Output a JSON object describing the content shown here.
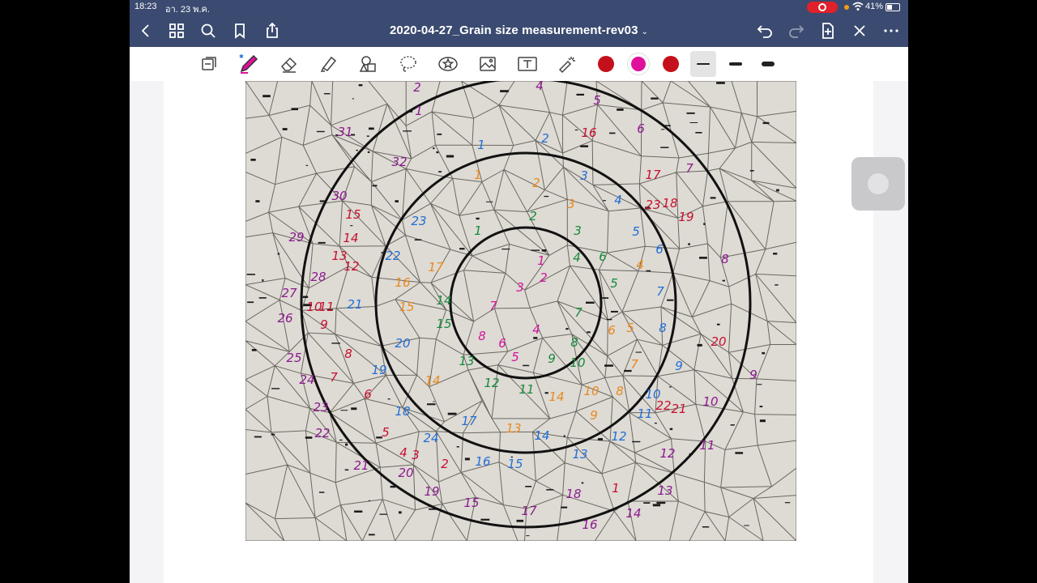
{
  "status": {
    "time": "18:23",
    "date": "อา. 23 พ.ค.",
    "battery": "41%"
  },
  "nav": {
    "title": "2020-04-27_Grain size measurement-rev03",
    "title_caret": "⌄"
  },
  "toolbar": {
    "tools": [
      "page-view-icon",
      "pen-icon",
      "eraser-icon",
      "highlighter-icon",
      "shapes-icon",
      "lasso-icon",
      "sticker-icon",
      "image-icon",
      "text-icon",
      "laser-pointer-icon"
    ],
    "colors": [
      "#c4101a",
      "#e0109a",
      "#c4101a"
    ],
    "active_color_index": 1,
    "active_stroke_index": 0
  },
  "colors": {
    "purple": "#8a1a8e",
    "red": "#c80f2e",
    "blue": "#1f6fd6",
    "orange": "#e8891c",
    "green": "#148a3c",
    "magenta": "#d4149a"
  },
  "labels": [
    {
      "t": "2",
      "c": "purple"
    },
    {
      "t": "4",
      "c": "purple"
    },
    {
      "t": "5",
      "c": "purple"
    },
    {
      "t": "1",
      "c": "purple"
    },
    {
      "t": "31",
      "c": "purple"
    },
    {
      "t": "1",
      "c": "blue"
    },
    {
      "t": "2",
      "c": "blue"
    },
    {
      "t": "16",
      "c": "red"
    },
    {
      "t": "6",
      "c": "purple"
    },
    {
      "t": "32",
      "c": "purple"
    },
    {
      "t": "1",
      "c": "orange"
    },
    {
      "t": "2",
      "c": "orange"
    },
    {
      "t": "3",
      "c": "blue"
    },
    {
      "t": "17",
      "c": "red"
    },
    {
      "t": "7",
      "c": "purple"
    },
    {
      "t": "30",
      "c": "purple"
    },
    {
      "t": "3",
      "c": "orange"
    },
    {
      "t": "4",
      "c": "blue"
    },
    {
      "t": "18",
      "c": "red"
    },
    {
      "t": "19",
      "c": "red"
    },
    {
      "t": "23",
      "c": "red"
    },
    {
      "t": "15",
      "c": "red"
    },
    {
      "t": "23",
      "c": "blue"
    },
    {
      "t": "2",
      "c": "green"
    },
    {
      "t": "29",
      "c": "purple"
    },
    {
      "t": "14",
      "c": "red"
    },
    {
      "t": "1",
      "c": "green"
    },
    {
      "t": "3",
      "c": "green"
    },
    {
      "t": "5",
      "c": "blue"
    },
    {
      "t": "22",
      "c": "blue"
    },
    {
      "t": "13",
      "c": "red"
    },
    {
      "t": "12",
      "c": "red"
    },
    {
      "t": "17",
      "c": "orange"
    },
    {
      "t": "1",
      "c": "magenta"
    },
    {
      "t": "4",
      "c": "green"
    },
    {
      "t": "6",
      "c": "green"
    },
    {
      "t": "6",
      "c": "blue"
    },
    {
      "t": "8",
      "c": "purple"
    },
    {
      "t": "4",
      "c": "orange"
    },
    {
      "t": "28",
      "c": "purple"
    },
    {
      "t": "16",
      "c": "orange"
    },
    {
      "t": "2",
      "c": "magenta"
    },
    {
      "t": "5",
      "c": "green"
    },
    {
      "t": "3",
      "c": "magenta"
    },
    {
      "t": "7",
      "c": "blue"
    },
    {
      "t": "27",
      "c": "purple"
    },
    {
      "t": "10",
      "c": "red"
    },
    {
      "t": "11",
      "c": "red"
    },
    {
      "t": "21",
      "c": "blue"
    },
    {
      "t": "14",
      "c": "green"
    },
    {
      "t": "15",
      "c": "orange"
    },
    {
      "t": "7",
      "c": "magenta"
    },
    {
      "t": "7",
      "c": "green"
    },
    {
      "t": "26",
      "c": "purple"
    },
    {
      "t": "9",
      "c": "red"
    },
    {
      "t": "15",
      "c": "green"
    },
    {
      "t": "4",
      "c": "magenta"
    },
    {
      "t": "6",
      "c": "orange"
    },
    {
      "t": "5",
      "c": "orange"
    },
    {
      "t": "8",
      "c": "blue"
    },
    {
      "t": "20",
      "c": "blue"
    },
    {
      "t": "8",
      "c": "magenta"
    },
    {
      "t": "6",
      "c": "magenta"
    },
    {
      "t": "8",
      "c": "green"
    },
    {
      "t": "20",
      "c": "red"
    },
    {
      "t": "8",
      "c": "red"
    },
    {
      "t": "5",
      "c": "magenta"
    },
    {
      "t": "9",
      "c": "green"
    },
    {
      "t": "10",
      "c": "green"
    },
    {
      "t": "25",
      "c": "purple"
    },
    {
      "t": "13",
      "c": "green"
    },
    {
      "t": "7",
      "c": "orange"
    },
    {
      "t": "9",
      "c": "blue"
    },
    {
      "t": "19",
      "c": "blue"
    },
    {
      "t": "24",
      "c": "purple"
    },
    {
      "t": "7",
      "c": "red"
    },
    {
      "t": "9",
      "c": "purple"
    },
    {
      "t": "12",
      "c": "green"
    },
    {
      "t": "14",
      "c": "orange"
    },
    {
      "t": "11",
      "c": "green"
    },
    {
      "t": "10",
      "c": "orange"
    },
    {
      "t": "8",
      "c": "orange"
    },
    {
      "t": "14",
      "c": "orange"
    },
    {
      "t": "6",
      "c": "red"
    },
    {
      "t": "10",
      "c": "blue"
    },
    {
      "t": "22",
      "c": "red"
    },
    {
      "t": "21",
      "c": "red"
    },
    {
      "t": "10",
      "c": "purple"
    },
    {
      "t": "23",
      "c": "purple"
    },
    {
      "t": "18",
      "c": "blue"
    },
    {
      "t": "9",
      "c": "orange"
    },
    {
      "t": "11",
      "c": "blue"
    },
    {
      "t": "17",
      "c": "blue"
    },
    {
      "t": "13",
      "c": "orange"
    },
    {
      "t": "22",
      "c": "purple"
    },
    {
      "t": "5",
      "c": "red"
    },
    {
      "t": "24",
      "c": "blue"
    },
    {
      "t": "14",
      "c": "blue"
    },
    {
      "t": "12",
      "c": "blue"
    },
    {
      "t": "11",
      "c": "purple"
    },
    {
      "t": "4",
      "c": "red"
    },
    {
      "t": "3",
      "c": "red"
    },
    {
      "t": "2",
      "c": "red"
    },
    {
      "t": "16",
      "c": "blue"
    },
    {
      "t": "15",
      "c": "blue"
    },
    {
      "t": "13",
      "c": "blue"
    },
    {
      "t": "12",
      "c": "purple"
    },
    {
      "t": "21",
      "c": "purple"
    },
    {
      "t": "20",
      "c": "purple"
    },
    {
      "t": "19",
      "c": "purple"
    },
    {
      "t": "18",
      "c": "purple"
    },
    {
      "t": "1",
      "c": "red"
    },
    {
      "t": "15",
      "c": "purple"
    },
    {
      "t": "13",
      "c": "purple"
    },
    {
      "t": "17",
      "c": "purple"
    },
    {
      "t": "14",
      "c": "purple"
    },
    {
      "t": "16",
      "c": "purple"
    }
  ]
}
